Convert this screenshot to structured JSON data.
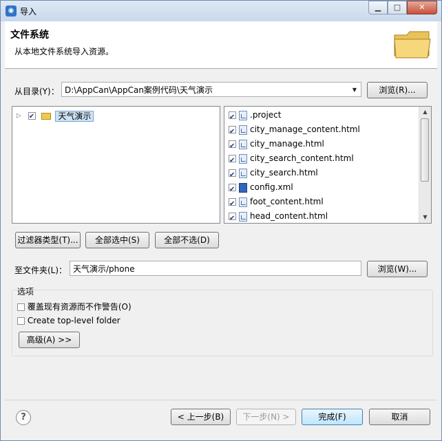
{
  "window": {
    "title": "导入"
  },
  "header": {
    "title": "文件系统",
    "subtitle": "从本地文件系统导入资源。"
  },
  "source": {
    "label": "从目录(Y)：",
    "value": "D:\\AppCan\\AppCan案例代码\\天气演示",
    "browse_label": "浏览(R)..."
  },
  "tree": {
    "items": [
      {
        "label": "天气演示",
        "checked": true
      }
    ]
  },
  "files": [
    {
      "name": ".project",
      "checked": true,
      "icon": "generic-file-icon"
    },
    {
      "name": "city_manage_content.html",
      "checked": true,
      "icon": "html-file-icon"
    },
    {
      "name": "city_manage.html",
      "checked": true,
      "icon": "html-file-icon"
    },
    {
      "name": "city_search_content.html",
      "checked": true,
      "icon": "html-file-icon"
    },
    {
      "name": "city_search.html",
      "checked": true,
      "icon": "html-file-icon"
    },
    {
      "name": "config.xml",
      "checked": true,
      "icon": "xml-file-icon"
    },
    {
      "name": "foot_content.html",
      "checked": true,
      "icon": "html-file-icon"
    },
    {
      "name": "head_content.html",
      "checked": true,
      "icon": "html-file-icon"
    }
  ],
  "selection_buttons": {
    "filter": "过滤器类型(T)...",
    "select_all": "全部选中(S)",
    "deselect_all": "全部不选(D)"
  },
  "target": {
    "label": "至文件夹(L)：",
    "value": "天气演示/phone",
    "browse_label": "浏览(W)..."
  },
  "options": {
    "title": "选项",
    "overwrite": {
      "label": "覆盖现有资源而不作警告(O)",
      "checked": false
    },
    "top_level": {
      "label": "Create top-level folder",
      "checked": false
    },
    "advanced_label": "高级(A) >>"
  },
  "footer": {
    "back": "< 上一步(B)",
    "next": "下一步(N) >",
    "finish": "完成(F)",
    "cancel": "取消"
  }
}
